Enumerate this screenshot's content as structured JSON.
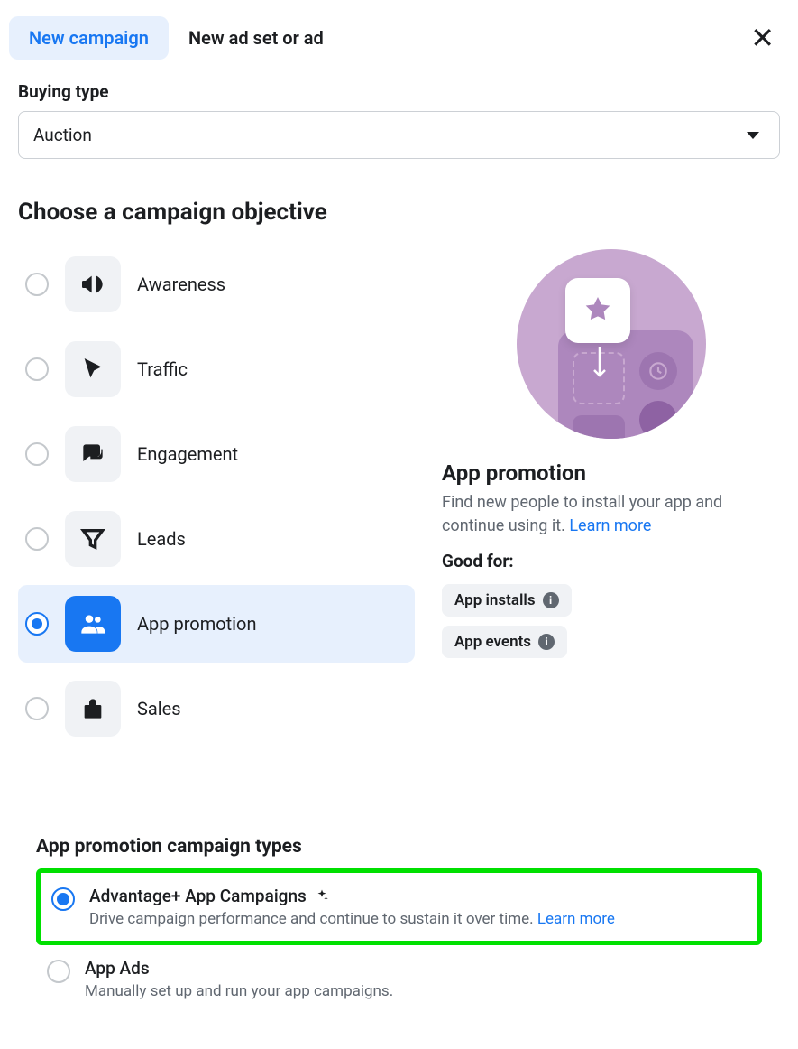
{
  "tabs": {
    "new_campaign": "New campaign",
    "new_ad_set": "New ad set or ad"
  },
  "buying_type": {
    "label": "Buying type",
    "value": "Auction"
  },
  "objective_heading": "Choose a campaign objective",
  "objectives": {
    "awareness": "Awareness",
    "traffic": "Traffic",
    "engagement": "Engagement",
    "leads": "Leads",
    "app_promotion": "App promotion",
    "sales": "Sales"
  },
  "detail": {
    "title": "App promotion",
    "description": "Find new people to install your app and continue using it. ",
    "learn_more": "Learn more",
    "good_for_label": "Good for:",
    "chips": {
      "installs": "App installs",
      "events": "App events"
    }
  },
  "campaign_types": {
    "heading": "App promotion campaign types",
    "advantage": {
      "title": "Advantage+ App Campaigns",
      "desc": "Drive campaign performance and continue to sustain it over time. ",
      "learn_more": "Learn more"
    },
    "app_ads": {
      "title": "App Ads",
      "desc": "Manually set up and run your app campaigns."
    }
  }
}
